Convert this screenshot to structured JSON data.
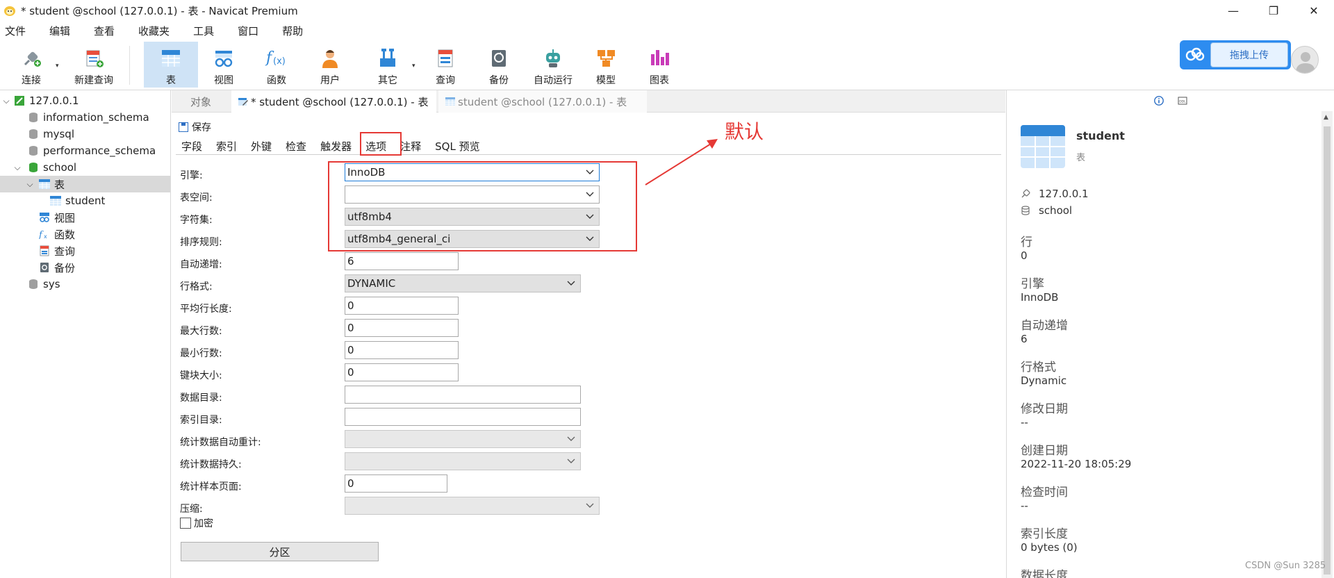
{
  "window": {
    "title": "* student @school (127.0.0.1) - 表 - Navicat Premium"
  },
  "menu": [
    "文件",
    "编辑",
    "查看",
    "收藏夹",
    "工具",
    "窗口",
    "帮助"
  ],
  "toolbar": {
    "connect": "连接",
    "new_query": "新建查询",
    "table": "表",
    "view": "视图",
    "function": "函数",
    "user": "用户",
    "other": "其它",
    "query": "查询",
    "backup": "备份",
    "automation": "自动运行",
    "model": "模型",
    "chart": "图表",
    "upload": "拖拽上传"
  },
  "tree": {
    "connection": "127.0.0.1",
    "databases": [
      "information_schema",
      "mysql",
      "performance_schema",
      "school",
      "sys"
    ],
    "school_children": {
      "tables": "表",
      "table_student": "student",
      "views": "视图",
      "functions": "函数",
      "queries": "查询",
      "backups": "备份"
    }
  },
  "tabs": {
    "objects": "对象",
    "active": "* student @school (127.0.0.1) - 表",
    "inactive": "student @school (127.0.0.1) - 表"
  },
  "editor": {
    "save": "保存",
    "subtabs": [
      "字段",
      "索引",
      "外键",
      "检查",
      "触发器",
      "选项",
      "注释",
      "SQL 预览"
    ],
    "active_subtab": "选项"
  },
  "options": {
    "engine_label": "引擎:",
    "engine_value": "InnoDB",
    "tablespace_label": "表空间:",
    "tablespace_value": "",
    "charset_label": "字符集:",
    "charset_value": "utf8mb4",
    "collation_label": "排序规则:",
    "collation_value": "utf8mb4_general_ci",
    "auto_inc_label": "自动递增:",
    "auto_inc_value": "6",
    "row_format_label": "行格式:",
    "row_format_value": "DYNAMIC",
    "avg_row_len_label": "平均行长度:",
    "avg_row_len_value": "0",
    "max_rows_label": "最大行数:",
    "max_rows_value": "0",
    "min_rows_label": "最小行数:",
    "min_rows_value": "0",
    "key_block_label": "键块大小:",
    "key_block_value": "0",
    "data_dir_label": "数据目录:",
    "data_dir_value": "",
    "index_dir_label": "索引目录:",
    "index_dir_value": "",
    "stats_auto_label": "统计数据自动重计:",
    "stats_persist_label": "统计数据持久:",
    "stats_pages_label": "统计样本页面:",
    "stats_pages_value": "0",
    "compression_label": "压缩:",
    "encryption_label": "加密",
    "partition_button": "分区"
  },
  "annotation": {
    "text": "默认",
    "color": "#e53935"
  },
  "info": {
    "name": "student",
    "type": "表",
    "connection": "127.0.0.1",
    "database": "school",
    "rows_label": "行",
    "rows_value": "0",
    "engine_label": "引擎",
    "engine_value": "InnoDB",
    "auto_inc_label": "自动递增",
    "auto_inc_value": "6",
    "row_format_label": "行格式",
    "row_format_value": "Dynamic",
    "modified_label": "修改日期",
    "modified_value": "--",
    "created_label": "创建日期",
    "created_value": "2022-11-20 18:05:29",
    "check_time_label": "检查时间",
    "check_time_value": "--",
    "index_len_label": "索引长度",
    "index_len_value": "0 bytes (0)",
    "data_len_label": "数据长度"
  },
  "watermark": "CSDN @Sun 3285",
  "colors": {
    "accent": "#2d8cf0",
    "selection": "#cfe3f6",
    "annotation_red": "#e53935"
  }
}
